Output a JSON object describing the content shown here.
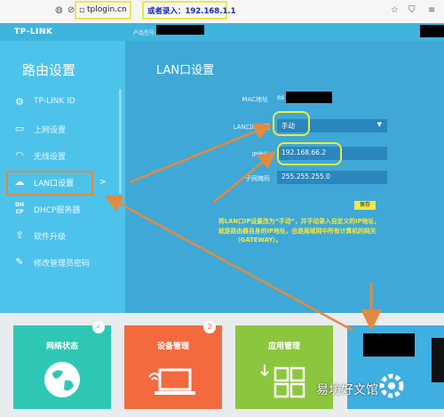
{
  "browser": {
    "url": "tplogin.cn",
    "url_note": "或者录入：192.168.1.1"
  },
  "header": {
    "brand": "TP-LINK",
    "model_label": "产品型号:"
  },
  "sidebar": {
    "title": "路由设置",
    "items": [
      {
        "label": "TP-LINK ID",
        "icon": "gear-icon"
      },
      {
        "label": "上网设置",
        "icon": "laptop-icon"
      },
      {
        "label": "无线设置",
        "icon": "wifi-icon"
      },
      {
        "label": "LAN口设置",
        "icon": "cloud-icon",
        "selected": true
      },
      {
        "label": "DHCP服务器",
        "icon": "dhcp-icon"
      },
      {
        "label": "软件升级",
        "icon": "upload-icon"
      },
      {
        "label": "修改管理员密码",
        "icon": "pencil-icon"
      }
    ]
  },
  "main": {
    "title": "LAN口设置",
    "fields": {
      "mac_label": "MAC地址",
      "mac_prefix": "B8",
      "mode_label": "LAN口IP设置",
      "mode_value": "手动",
      "ip_label": "IP地址",
      "ip_value": "192.168.66.2",
      "mask_label": "子网掩码",
      "mask_value": "255.255.255.0"
    },
    "save_label": "保存",
    "note_lines": [
      "将LAN口IP设置改为“手动”，并手动录入自定义的IP地址，",
      "就是路由器自身的IP地址，也是局域网中所有计算机的网关",
      "（GATEWAY）。"
    ]
  },
  "tiles": [
    {
      "label": "网络状态",
      "badge": "✓",
      "icon": "globe-icon",
      "color": "#2ec7b4"
    },
    {
      "label": "设备管理",
      "badge": "2",
      "icon": "laptop-wifi-icon",
      "color": "#f26a3e"
    },
    {
      "label": "应用管理",
      "icon": "apps-grid-icon",
      "color": "#8cc63e"
    },
    {
      "label": "",
      "icon": "settings-icon",
      "color": "#3faee0"
    }
  ],
  "watermark": "易坊好文馆",
  "colors": {
    "highlight_yellow": "#e7ea45",
    "annotation_orange": "#e28a3f",
    "note_yellow": "#f7e741"
  }
}
